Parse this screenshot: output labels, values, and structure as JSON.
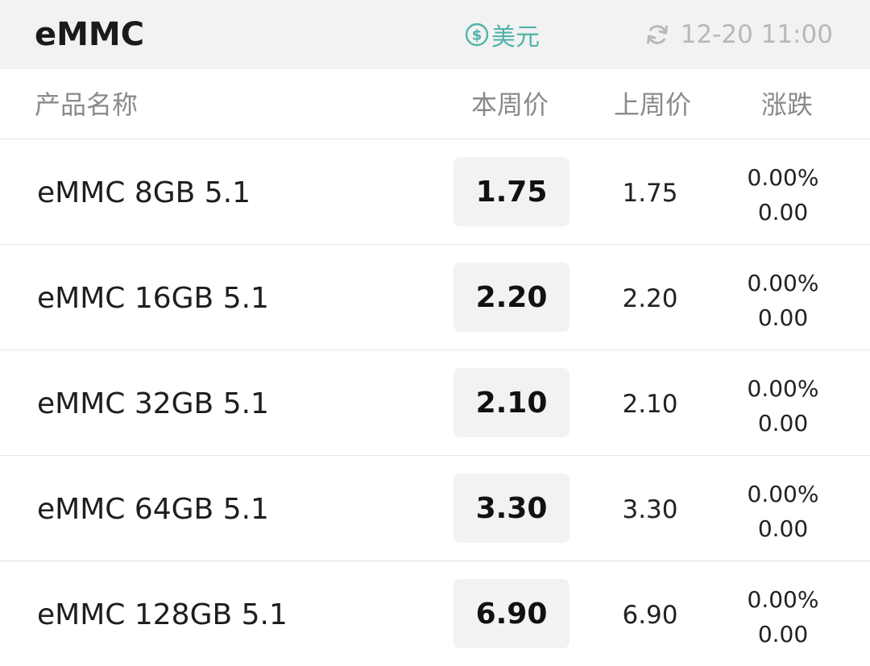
{
  "header": {
    "title": "eMMC",
    "currency_label": "美元",
    "currency_icon": "dollar-circle-icon",
    "update_time": "12-20 11:00",
    "refresh_icon": "refresh-icon",
    "accent_color": "#4fb3a9"
  },
  "columns": {
    "name": "产品名称",
    "this_week": "本周价",
    "last_week": "上周价",
    "change": "涨跌"
  },
  "rows": [
    {
      "name": "eMMC 8GB 5.1",
      "this_week": "1.75",
      "last_week": "1.75",
      "change_pct": "0.00%",
      "change_abs": "0.00"
    },
    {
      "name": "eMMC 16GB 5.1",
      "this_week": "2.20",
      "last_week": "2.20",
      "change_pct": "0.00%",
      "change_abs": "0.00"
    },
    {
      "name": "eMMC 32GB 5.1",
      "this_week": "2.10",
      "last_week": "2.10",
      "change_pct": "0.00%",
      "change_abs": "0.00"
    },
    {
      "name": "eMMC 64GB 5.1",
      "this_week": "3.30",
      "last_week": "3.30",
      "change_pct": "0.00%",
      "change_abs": "0.00"
    },
    {
      "name": "eMMC 128GB 5.1",
      "this_week": "6.90",
      "last_week": "6.90",
      "change_pct": "0.00%",
      "change_abs": "0.00"
    }
  ]
}
